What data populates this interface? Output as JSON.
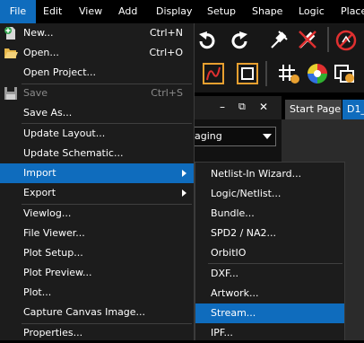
{
  "colors": {
    "accent": "#0f6cbd",
    "menu_bg": "#1c1c1c",
    "text": "#ffffff",
    "disabled_text": "#8a8a8a"
  },
  "menubar": {
    "file": "File",
    "edit": "Edit",
    "view": "View",
    "add": "Add",
    "display": "Display",
    "setup": "Setup",
    "shape": "Shape",
    "logic": "Logic",
    "place": "Place"
  },
  "background": {
    "combo_text": "aging",
    "tab_start": "Start Page",
    "tab_d1": "D1_",
    "panel_min": "–",
    "panel_restore": "⧉",
    "panel_close": "✕"
  },
  "file_menu": {
    "new": {
      "label": "New...",
      "shortcut": "Ctrl+N",
      "icon": "new-file-icon"
    },
    "open": {
      "label": "Open...",
      "shortcut": "Ctrl+O",
      "icon": "open-folder-icon"
    },
    "open_project": {
      "label": "Open Project..."
    },
    "save": {
      "label": "Save",
      "shortcut": "Ctrl+S",
      "icon": "save-icon",
      "disabled": true
    },
    "save_as": {
      "label": "Save As..."
    },
    "update_layout": {
      "label": "Update Layout..."
    },
    "update_schematic": {
      "label": "Update Schematic..."
    },
    "import": {
      "label": "Import"
    },
    "export": {
      "label": "Export"
    },
    "viewlog": {
      "label": "Viewlog..."
    },
    "file_viewer": {
      "label": "File Viewer..."
    },
    "plot_setup": {
      "label": "Plot Setup..."
    },
    "plot_preview": {
      "label": "Plot Preview..."
    },
    "plot": {
      "label": "Plot..."
    },
    "capture": {
      "label": "Capture Canvas Image..."
    },
    "properties": {
      "label": "Properties..."
    }
  },
  "import_submenu": {
    "netlist_in_wizard": "Netlist-In Wizard...",
    "logic_netlist": "Logic/Netlist...",
    "bundle": "Bundle...",
    "spd2_na2": "SPD2 / NA2...",
    "orbitio": "OrbitIO",
    "dxf": "DXF...",
    "artwork": "Artwork...",
    "stream": "Stream...",
    "ipf": "IPF..."
  }
}
